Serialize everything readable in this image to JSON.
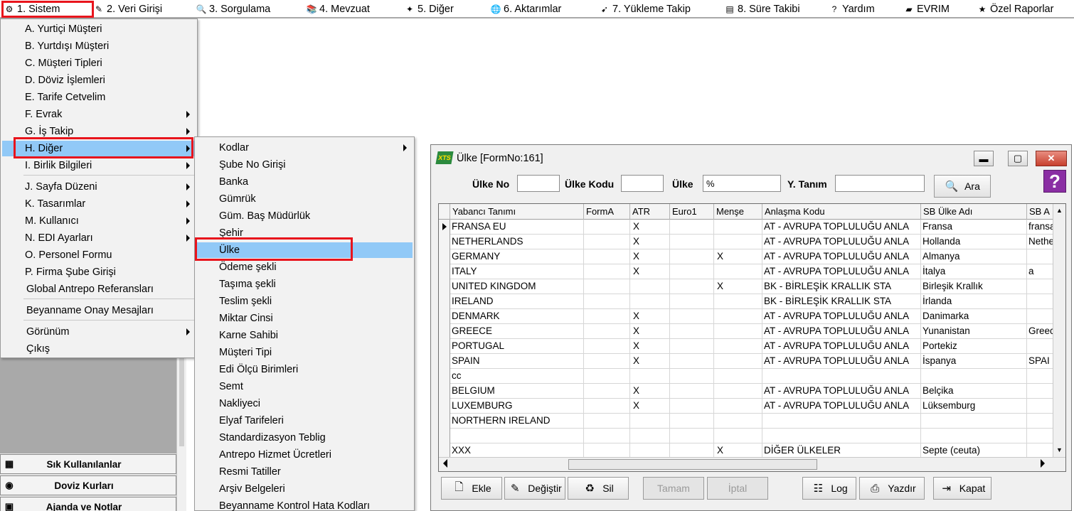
{
  "menubar": {
    "items": [
      {
        "label": "1.  Sistem",
        "icon": "gear-icon",
        "glyph": "⚙"
      },
      {
        "label": "2.  Veri Girişi",
        "icon": "pencil-icon",
        "glyph": "✎"
      },
      {
        "label": "3.  Sorgulama",
        "icon": "magnifier-icon",
        "glyph": "🔍"
      },
      {
        "label": "4.  Mevzuat",
        "icon": "books-icon",
        "glyph": "📚"
      },
      {
        "label": "5.  Diğer",
        "icon": "puzzle-icon",
        "glyph": "✦"
      },
      {
        "label": "6.  Aktarımlar",
        "icon": "globe-icon",
        "glyph": "🌐"
      },
      {
        "label": "7.  Yükleme Takip",
        "icon": "truck-icon",
        "glyph": "➹"
      },
      {
        "label": "8. Süre Takibi",
        "icon": "calendar-icon",
        "glyph": "▤"
      },
      {
        "label": "Yardım",
        "icon": "help-icon",
        "glyph": "?"
      },
      {
        "label": "EVRIM",
        "icon": "book-icon",
        "glyph": "▰"
      },
      {
        "label": "Özel Raporlar",
        "icon": "star-icon",
        "glyph": "★"
      }
    ]
  },
  "sistem_menu": {
    "items": [
      {
        "label": "A.  Yurtiçi Müşteri"
      },
      {
        "label": "B.  Yurtdışı Müşteri"
      },
      {
        "label": "C.  Müşteri Tipleri"
      },
      {
        "label": "D.  Döviz İşlemleri"
      },
      {
        "label": "E.  Tarife Cetvelim"
      },
      {
        "label": "F.  Evrak",
        "sub": true
      },
      {
        "label": "G.  İş Takip",
        "sub": true
      },
      {
        "label": "H.  Diğer",
        "sub": true,
        "highlighted": true
      },
      {
        "label": "I.  Birlik Bilgileri",
        "sub": true
      },
      {
        "label": "J.  Sayfa Düzeni",
        "sub": true
      },
      {
        "label": "K.  Tasarımlar",
        "sub": true
      },
      {
        "label": "M.  Kullanıcı",
        "sub": true
      },
      {
        "label": "N.  EDI Ayarları",
        "sub": true
      },
      {
        "label": "O.  Personel Formu"
      },
      {
        "label": "P.  Firma Şube Girişi"
      },
      {
        "label": "Global Antrepo Referansları"
      },
      {
        "label": "Beyanname Onay Mesajları"
      },
      {
        "label": "Görünüm",
        "sub": true
      },
      {
        "label": "Çıkış"
      }
    ]
  },
  "diger_submenu": {
    "items": [
      {
        "label": "Kodlar",
        "sub": true
      },
      {
        "label": "Şube No Girişi"
      },
      {
        "label": "Banka"
      },
      {
        "label": "Gümrük"
      },
      {
        "label": "Güm. Baş Müdürlük"
      },
      {
        "label": "Şehir"
      },
      {
        "label": "Ülke",
        "highlighted": true
      },
      {
        "label": "Ödeme şekli"
      },
      {
        "label": "Taşıma şekli"
      },
      {
        "label": "Teslim şekli"
      },
      {
        "label": "Miktar Cinsi"
      },
      {
        "label": "Karne Sahibi"
      },
      {
        "label": "Müşteri  Tipi"
      },
      {
        "label": "Edi Ölçü Birimleri"
      },
      {
        "label": "Semt"
      },
      {
        "label": "Nakliyeci"
      },
      {
        "label": "Elyaf Tarifeleri"
      },
      {
        "label": "Standardizasyon Teblig"
      },
      {
        "label": "Antrepo Hizmet Ücretleri"
      },
      {
        "label": "Resmi Tatiller"
      },
      {
        "label": "Arşiv Belgeleri"
      },
      {
        "label": "Beyanname Kontrol Hata Kodları"
      }
    ]
  },
  "left_panel": {
    "buttons": [
      {
        "label": "Sık Kullanılanlar",
        "icon": "calendar-icon",
        "glyph": "▦"
      },
      {
        "label": "Doviz Kurları",
        "icon": "coins-icon",
        "glyph": "◉"
      },
      {
        "label": "Ajanda ve Notlar",
        "icon": "notebook-icon",
        "glyph": "▣"
      }
    ]
  },
  "window": {
    "title": "Ülke [FormNo:161]",
    "logo_text": "XTS",
    "min_glyph": "▬",
    "max_glyph": "▢",
    "close_glyph": "✕",
    "help_glyph": "?",
    "search": {
      "ulke_no_label": "Ülke No",
      "ulke_no_value": "",
      "ulke_kodu_label": "Ülke Kodu",
      "ulke_kodu_value": "",
      "ulke_label": "Ülke",
      "ulke_value": "%",
      "y_tanim_label": "Y. Tanım",
      "y_tanim_value": "",
      "ara_label": "Ara"
    },
    "grid": {
      "columns": [
        "Yabancı Tanımı",
        "FormA",
        "ATR",
        "Euro1",
        "Menşe",
        "Anlaşma Kodu",
        "SB Ülke Adı",
        "SB A"
      ],
      "rows": [
        [
          "FRANSA EU",
          "",
          "X",
          "",
          "",
          "AT    - AVRUPA TOPLULUĞU ANLA",
          "Fransa",
          "fransa"
        ],
        [
          "NETHERLANDS",
          "",
          "X",
          "",
          "",
          "AT    - AVRUPA TOPLULUĞU ANLA",
          "Hollanda",
          "Nether"
        ],
        [
          "GERMANY",
          "",
          "X",
          "",
          "X",
          "AT    - AVRUPA TOPLULUĞU ANLA",
          "Almanya",
          ""
        ],
        [
          "ITALY",
          "",
          "X",
          "",
          "",
          "AT    - AVRUPA TOPLULUĞU ANLA",
          "İtalya",
          "a"
        ],
        [
          "UNITED KINGDOM",
          "",
          "",
          "",
          "X",
          "BK - BİRLEŞİK KRALLIK STA",
          "Birleşik Krallık",
          ""
        ],
        [
          "IRELAND",
          "",
          "",
          "",
          "",
          "BK - BİRLEŞİK KRALLIK STA",
          "İrlanda",
          ""
        ],
        [
          "DENMARK",
          "",
          "X",
          "",
          "",
          "AT    - AVRUPA TOPLULUĞU ANLA",
          "Danimarka",
          ""
        ],
        [
          "GREECE",
          "",
          "X",
          "",
          "",
          "AT    - AVRUPA TOPLULUĞU ANLA",
          "Yunanistan",
          "Greec"
        ],
        [
          "PORTUGAL",
          "",
          "X",
          "",
          "",
          "AT    - AVRUPA TOPLULUĞU ANLA",
          "Portekiz",
          ""
        ],
        [
          "SPAIN",
          "",
          "X",
          "",
          "",
          "AT    - AVRUPA TOPLULUĞU ANLA",
          "İspanya",
          "SPAI"
        ],
        [
          "cc",
          "",
          "",
          "",
          "",
          "",
          "",
          ""
        ],
        [
          "BELGIUM",
          "",
          "X",
          "",
          "",
          "AT    - AVRUPA TOPLULUĞU ANLA",
          "Belçika",
          ""
        ],
        [
          "LUXEMBURG",
          "",
          "X",
          "",
          "",
          "AT    - AVRUPA TOPLULUĞU ANLA",
          "Lüksemburg",
          ""
        ],
        [
          "NORTHERN IRELAND",
          "",
          "",
          "",
          "",
          "",
          "",
          ""
        ],
        [
          "",
          "",
          "",
          "",
          "",
          "",
          "",
          ""
        ],
        [
          "XXX",
          "",
          "",
          "",
          "X",
          "DİĞER ÜLKELER",
          "Septe (ceuta)",
          ""
        ]
      ]
    },
    "buttons": [
      {
        "label": "Ekle",
        "icon": "new-document-icon",
        "glyph": "🗋",
        "enabled": true
      },
      {
        "label": "Değiştir",
        "icon": "edit-icon",
        "glyph": "✎",
        "enabled": true
      },
      {
        "label": "Sil",
        "icon": "recycle-bin-icon",
        "glyph": "♻",
        "enabled": true
      },
      {
        "label": "Tamam",
        "icon": "",
        "glyph": "",
        "enabled": false
      },
      {
        "label": "İptal",
        "icon": "",
        "glyph": "",
        "enabled": false
      },
      {
        "label": "Log",
        "icon": "log-icon",
        "glyph": "☷",
        "enabled": true
      },
      {
        "label": "Yazdır",
        "icon": "printer-icon",
        "glyph": "⎙",
        "enabled": true
      },
      {
        "label": "Kapat",
        "icon": "exit-door-icon",
        "glyph": "⇥",
        "enabled": true
      }
    ]
  }
}
